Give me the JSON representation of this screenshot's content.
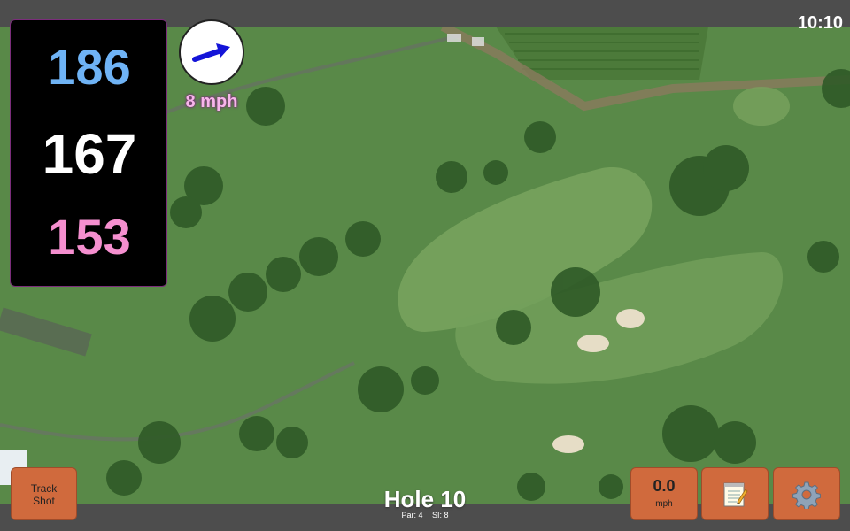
{
  "status": {
    "time": "10:10"
  },
  "distances": {
    "back": "186",
    "middle": "167",
    "front": "153"
  },
  "wind": {
    "speed_label": "8 mph",
    "direction_icon": "arrow-right-icon"
  },
  "hole": {
    "title": "Hole 10",
    "par": "Par: 4",
    "si": "SI: 8"
  },
  "buttons": {
    "track_shot_line1": "Track",
    "track_shot_line2": "Shot",
    "wind_value": "0.0",
    "wind_unit": "mph",
    "notes_icon": "notepad-icon",
    "settings_icon": "gear-icon"
  },
  "colors": {
    "back_distance": "#6fb3f5",
    "middle_distance": "#ffffff",
    "front_distance": "#f58fcf",
    "button": "#d06a3d"
  }
}
